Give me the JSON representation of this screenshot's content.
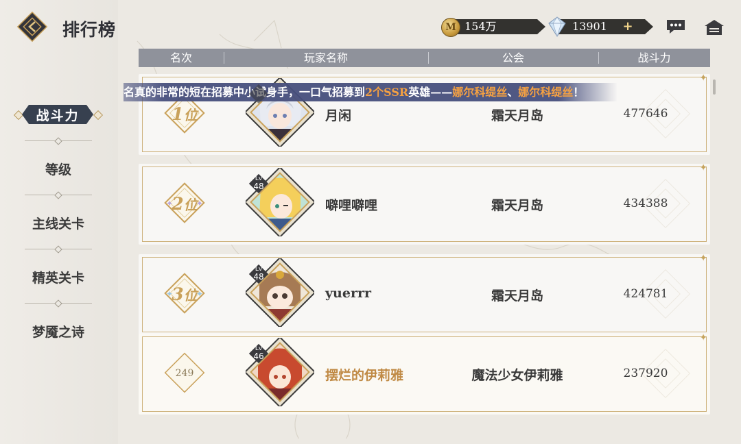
{
  "header": {
    "title": "排行榜",
    "gold_amount": "154万",
    "gem_amount": "13901",
    "gold_icon_glyph": "M",
    "plus_label": "+"
  },
  "icons": {
    "logo": "back-logo-icon",
    "chat": "chat-icon",
    "home": "home-icon"
  },
  "side_menu": {
    "items": [
      {
        "label": "战斗力",
        "active": true
      },
      {
        "label": "等级",
        "active": false
      },
      {
        "label": "主线关卡",
        "active": false
      },
      {
        "label": "精英关卡",
        "active": false
      },
      {
        "label": "梦魇之诗",
        "active": false
      }
    ]
  },
  "table": {
    "columns": [
      "名次",
      "玩家名称",
      "公会",
      "战斗力"
    ],
    "rows": [
      {
        "rank": "1",
        "rank_suffix": "位",
        "level": "48",
        "name": "月闲",
        "guild": "霜天月岛",
        "power": "477646"
      },
      {
        "rank": "2",
        "rank_suffix": "位",
        "level": "48",
        "name": "噼哩噼哩",
        "guild": "霜天月岛",
        "power": "434388"
      },
      {
        "rank": "3",
        "rank_suffix": "位",
        "level": "48",
        "name": "yuerrr",
        "guild": "霜天月岛",
        "power": "424781"
      },
      {
        "rank": "249",
        "rank_suffix": "",
        "level": "46",
        "name": "摆烂的伊莉雅",
        "guild": "魔法少女伊莉雅",
        "power": "237920",
        "is_self": true
      }
    ],
    "level_prefix": "Lv"
  },
  "announcement": {
    "part1": "名真的非常的短在招募中小试身手，一口气招募到",
    "highlight1": "2个SSR",
    "part2": "英雄——",
    "highlight2": "娜尔科缇丝",
    "part3": "、",
    "highlight3": "娜尔科缇丝",
    "part4": "！"
  },
  "colors": {
    "gold_accent": "#c9a15a",
    "header_bar": "#8f929b",
    "active_tab": "#37404f",
    "marquee": "#474f7d",
    "highlight_orange": "#f5a142"
  }
}
